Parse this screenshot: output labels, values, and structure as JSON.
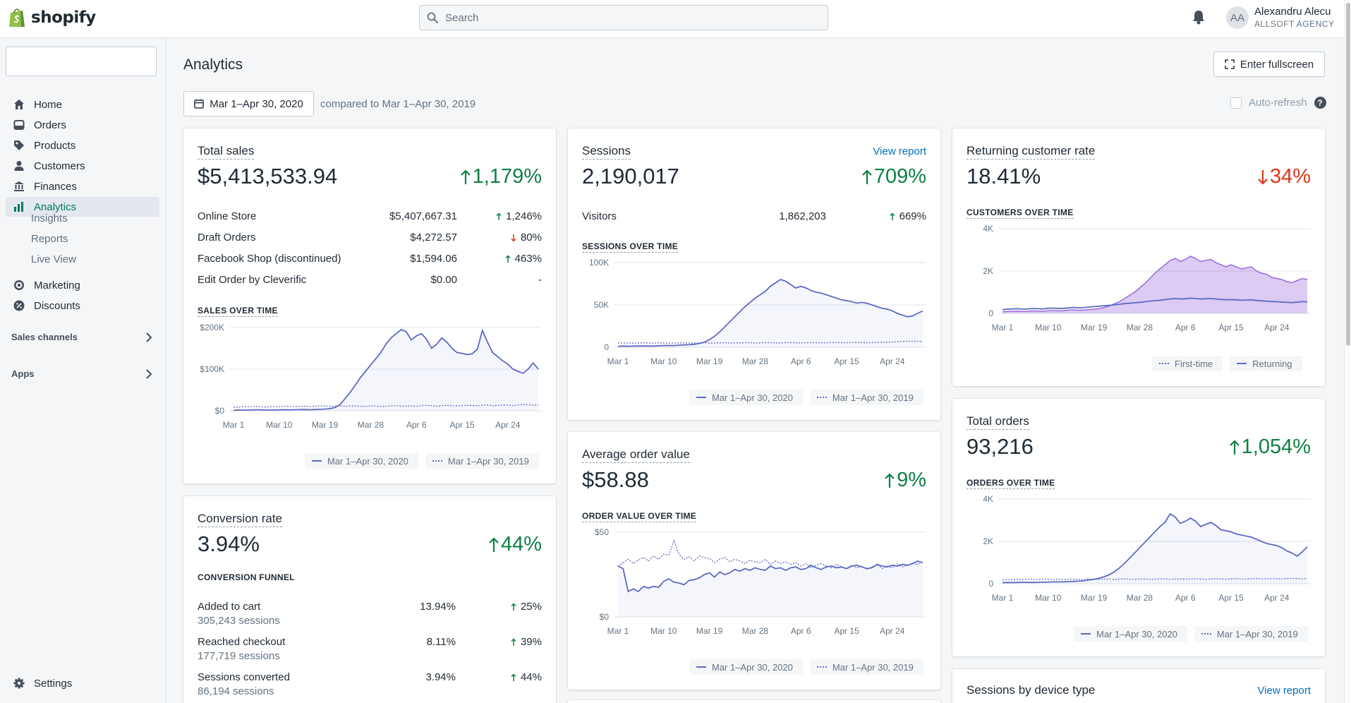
{
  "topbar": {
    "logo_text": "shopify",
    "search_placeholder": "Search",
    "avatar_initials": "AA",
    "user_name": "Alexandru Alecu",
    "user_agency": "ALLSOFT AGENCY"
  },
  "sidebar": {
    "items": [
      {
        "label": "Home",
        "icon": "home-icon"
      },
      {
        "label": "Orders",
        "icon": "orders-icon"
      },
      {
        "label": "Products",
        "icon": "tag-icon"
      },
      {
        "label": "Customers",
        "icon": "person-icon"
      },
      {
        "label": "Finances",
        "icon": "bank-icon"
      },
      {
        "label": "Analytics",
        "icon": "bar-chart-icon",
        "active": true
      },
      {
        "label": "Marketing",
        "icon": "target-icon"
      },
      {
        "label": "Discounts",
        "icon": "discount-icon"
      }
    ],
    "analytics_sub": [
      "Insights",
      "Reports",
      "Live View"
    ],
    "sections": [
      "Sales channels",
      "Apps"
    ],
    "settings_label": "Settings"
  },
  "page": {
    "title": "Analytics",
    "fullscreen_label": "Enter fullscreen",
    "date_range": "Mar 1–Apr 30, 2020",
    "compared_to": "compared to Mar 1–Apr 30, 2019",
    "auto_refresh": "Auto-refresh"
  },
  "legend": {
    "current": "Mar 1–Apr 30, 2020",
    "previous": "Mar 1–Apr 30, 2019"
  },
  "colors": {
    "accent": "#47c1bf",
    "positive": "#108043",
    "negative": "#de3618",
    "link": "#006fbb",
    "purple": "#9c6ade"
  },
  "total_sales": {
    "title": "Total sales",
    "value": "$5,413,533.94",
    "change": "1,179%",
    "rows": [
      {
        "label": "Online Store",
        "value": "$5,407,667.31",
        "change": "1,246%",
        "dir": "up"
      },
      {
        "label": "Draft Orders",
        "value": "$4,272.57",
        "change": "80%",
        "dir": "down"
      },
      {
        "label": "Facebook Shop (discontinued)",
        "value": "$1,594.06",
        "change": "463%",
        "dir": "up"
      },
      {
        "label": "Edit Order by Cleverific",
        "value": "$0.00",
        "change": "-",
        "dir": "none"
      }
    ],
    "chart_label": "SALES OVER TIME"
  },
  "sessions": {
    "title": "Sessions",
    "view_report": "View report",
    "value": "2,190,017",
    "change": "709%",
    "visitors_label": "Visitors",
    "visitors_value": "1,862,203",
    "visitors_change": "669%",
    "chart_label": "SESSIONS OVER TIME"
  },
  "returning": {
    "title": "Returning customer rate",
    "value": "18.41%",
    "change": "34%",
    "chart_label": "CUSTOMERS OVER TIME",
    "legend_first": "First-time",
    "legend_returning": "Returning"
  },
  "conversion": {
    "title": "Conversion rate",
    "value": "3.94%",
    "change": "44%",
    "funnel_label": "CONVERSION FUNNEL",
    "rows": [
      {
        "label": "Added to cart",
        "sub": "305,243 sessions",
        "value": "13.94%",
        "change": "25%"
      },
      {
        "label": "Reached checkout",
        "sub": "177,719 sessions",
        "value": "8.11%",
        "change": "39%"
      },
      {
        "label": "Sessions converted",
        "sub": "86,194 sessions",
        "value": "3.94%",
        "change": "44%"
      }
    ]
  },
  "aov": {
    "title": "Average order value",
    "value": "$58.88",
    "change": "9%",
    "chart_label": "ORDER VALUE OVER TIME"
  },
  "orders": {
    "title": "Total orders",
    "value": "93,216",
    "change": "1,054%",
    "chart_label": "ORDERS OVER TIME"
  },
  "device": {
    "title": "Sessions by device type",
    "view_report": "View report"
  },
  "chart_data": [
    {
      "type": "line",
      "id": "sales",
      "x_ticks": [
        "Mar 1",
        "Mar 10",
        "Mar 19",
        "Mar 28",
        "Apr 6",
        "Apr 15",
        "Apr 24"
      ],
      "y_ticks": [
        "$0",
        "$100K",
        "$200K"
      ],
      "ylim": [
        0,
        200000
      ],
      "series": [
        {
          "values": [
            1000,
            2000,
            1500,
            1800,
            2200,
            2500,
            2000,
            1800,
            2100,
            2400,
            2600,
            2200,
            2500,
            2800,
            3000,
            2600,
            3000,
            3500,
            4000,
            5000,
            8000,
            15000,
            30000,
            45000,
            62000,
            80000,
            95000,
            110000,
            125000,
            140000,
            160000,
            175000,
            185000,
            195000,
            190000,
            170000,
            180000,
            185000,
            172000,
            150000,
            160000,
            175000,
            165000,
            150000,
            140000,
            138000,
            135000,
            137000,
            148000,
            193000,
            165000,
            140000,
            130000,
            120000,
            112000,
            100000,
            95000,
            90000,
            100000,
            115000,
            100000
          ]
        },
        {
          "values": [
            8000,
            9000,
            10000,
            9500,
            11000,
            10000,
            9000,
            9500,
            10000,
            9500,
            11000,
            10500,
            10000,
            10500,
            11000,
            10000,
            11000,
            12000,
            11500,
            10500,
            11000,
            11500,
            10500,
            11500,
            12000,
            11000,
            10500,
            11500,
            12000,
            10500,
            11000,
            12000,
            12500,
            11000,
            11500,
            12000,
            11000,
            12500,
            13000,
            12500,
            11000,
            12000,
            13000,
            12000,
            11500,
            12500,
            13000,
            12500,
            12000,
            13000,
            14000,
            12000,
            13000,
            14000,
            13500,
            12500,
            14000,
            15000,
            14500,
            13500,
            14000
          ]
        }
      ]
    },
    {
      "type": "line",
      "id": "sessions",
      "x_ticks": [
        "Mar 1",
        "Mar 10",
        "Mar 19",
        "Mar 28",
        "Apr 6",
        "Apr 15",
        "Apr 24"
      ],
      "y_ticks": [
        "0",
        "50K",
        "100K"
      ],
      "ylim": [
        0,
        100000
      ],
      "series": [
        {
          "values": [
            1000,
            1500,
            1200,
            1300,
            1600,
            1500,
            1400,
            1500,
            1800,
            2000,
            2200,
            2000,
            2500,
            2800,
            3000,
            3500,
            4500,
            6000,
            9000,
            13000,
            18000,
            24000,
            30000,
            36000,
            42000,
            48000,
            53000,
            58000,
            62000,
            66000,
            72000,
            76000,
            80000,
            78000,
            74000,
            70000,
            72000,
            70000,
            67000,
            65000,
            64000,
            62000,
            60000,
            58000,
            56000,
            55000,
            54000,
            52000,
            53000,
            52000,
            50000,
            48000,
            46000,
            45000,
            43000,
            40000,
            38000,
            36000,
            37000,
            40000,
            43000
          ]
        },
        {
          "values": [
            5000,
            5200,
            5000,
            4800,
            5100,
            5300,
            5000,
            4900,
            5200,
            5100,
            4800,
            5000,
            5200,
            5100,
            4900,
            5000,
            5200,
            5400,
            5100,
            5000,
            5200,
            5300,
            5100,
            5000,
            5200,
            5400,
            5300,
            5100,
            5200,
            5500,
            5300,
            5100,
            5200,
            5400,
            5600,
            5200,
            5100,
            5300,
            5500,
            5400,
            5200,
            5300,
            5600,
            5500,
            5300,
            5400,
            5600,
            5800,
            5500,
            5400,
            5600,
            5900,
            6000,
            5800,
            6200,
            6500,
            7000,
            7200,
            7000,
            7100,
            6800
          ]
        }
      ]
    },
    {
      "type": "area",
      "id": "customers",
      "x_ticks": [
        "Mar 1",
        "Mar 10",
        "Mar 19",
        "Mar 28",
        "Apr 6",
        "Apr 15",
        "Apr 24"
      ],
      "y_ticks": [
        "0",
        "2K",
        "4K"
      ],
      "ylim": [
        0,
        4000
      ],
      "series": [
        {
          "name": "First-time",
          "values": [
            80,
            90,
            100,
            110,
            95,
            100,
            120,
            110,
            100,
            130,
            140,
            120,
            130,
            160,
            170,
            150,
            160,
            180,
            200,
            220,
            280,
            350,
            450,
            550,
            700,
            850,
            1000,
            1200,
            1400,
            1650,
            1900,
            2100,
            2300,
            2500,
            2600,
            2450,
            2550,
            2700,
            2600,
            2450,
            2500,
            2550,
            2400,
            2300,
            2200,
            2300,
            2200,
            2100,
            2150,
            2200,
            2000,
            1900,
            1850,
            1700,
            1650,
            1600,
            1500,
            1450,
            1550,
            1650,
            1600
          ]
        },
        {
          "name": "Returning",
          "values": [
            180,
            200,
            210,
            220,
            200,
            210,
            230,
            220,
            210,
            240,
            250,
            230,
            240,
            260,
            280,
            260,
            270,
            300,
            320,
            340,
            360,
            380,
            400,
            430,
            460,
            480,
            500,
            520,
            550,
            580,
            600,
            620,
            650,
            680,
            700,
            680,
            690,
            720,
            700,
            680,
            690,
            700,
            680,
            660,
            640,
            650,
            640,
            620,
            630,
            640,
            610,
            590,
            580,
            560,
            550,
            540,
            520,
            510,
            530,
            560,
            540
          ]
        }
      ]
    },
    {
      "type": "line",
      "id": "order_value",
      "x_ticks": [
        "Mar 1",
        "Mar 10",
        "Mar 19",
        "Mar 28",
        "Apr 6",
        "Apr 15",
        "Apr 24"
      ],
      "y_ticks": [
        "$0",
        "$50"
      ],
      "ylim": [
        0,
        100
      ],
      "series": [
        {
          "values": [
            60,
            57,
            30,
            33,
            30,
            36,
            34,
            36,
            35,
            42,
            45,
            41,
            40,
            38,
            43,
            44,
            46,
            50,
            52,
            47,
            53,
            50,
            52,
            56,
            54,
            57,
            55,
            58,
            56,
            55,
            60,
            57,
            58,
            55,
            58,
            59,
            56,
            57,
            61,
            58,
            56,
            59,
            60,
            58,
            59,
            57,
            60,
            61,
            59,
            57,
            58,
            62,
            60,
            59,
            61,
            60,
            62,
            61,
            63,
            66,
            64
          ]
        },
        {
          "values": [
            60,
            64,
            68,
            63,
            67,
            70,
            66,
            72,
            68,
            74,
            73,
            90,
            74,
            68,
            71,
            66,
            72,
            70,
            69,
            64,
            68,
            70,
            65,
            68,
            66,
            63,
            67,
            65,
            64,
            68,
            62,
            66,
            63,
            65,
            62,
            64,
            60,
            63,
            58,
            61,
            63,
            60,
            58,
            62,
            59,
            57,
            61,
            58,
            60,
            56,
            59,
            62,
            57,
            60,
            58,
            62,
            59,
            61,
            63,
            62,
            65
          ]
        }
      ]
    },
    {
      "type": "line",
      "id": "orders",
      "x_ticks": [
        "Mar 1",
        "Mar 10",
        "Mar 19",
        "Mar 28",
        "Apr 6",
        "Apr 15",
        "Apr 24"
      ],
      "y_ticks": [
        "0",
        "2K",
        "4K"
      ],
      "ylim": [
        0,
        4000
      ],
      "series": [
        {
          "values": [
            50,
            60,
            55,
            60,
            70,
            65,
            60,
            70,
            75,
            80,
            90,
            85,
            90,
            100,
            110,
            120,
            140,
            170,
            210,
            260,
            330,
            420,
            560,
            740,
            960,
            1200,
            1450,
            1700,
            1950,
            2200,
            2450,
            2700,
            2900,
            3300,
            3150,
            2850,
            2950,
            3100,
            2950,
            2700,
            2800,
            2900,
            2750,
            2550,
            2500,
            2450,
            2350,
            2300,
            2250,
            2200,
            2100,
            2000,
            1900,
            1850,
            1800,
            1700,
            1550,
            1450,
            1300,
            1500,
            1750
          ]
        },
        {
          "values": [
            180,
            200,
            190,
            210,
            200,
            220,
            210,
            200,
            220,
            210,
            200,
            215,
            205,
            220,
            210,
            200,
            215,
            225,
            210,
            205,
            220,
            215,
            205,
            220,
            230,
            215,
            210,
            225,
            220,
            205,
            215,
            230,
            225,
            210,
            220,
            230,
            215,
            225,
            235,
            220,
            210,
            225,
            235,
            220,
            215,
            230,
            240,
            225,
            220,
            235,
            245,
            225,
            230,
            240,
            235,
            225,
            240,
            250,
            245,
            235,
            240
          ]
        }
      ]
    }
  ]
}
